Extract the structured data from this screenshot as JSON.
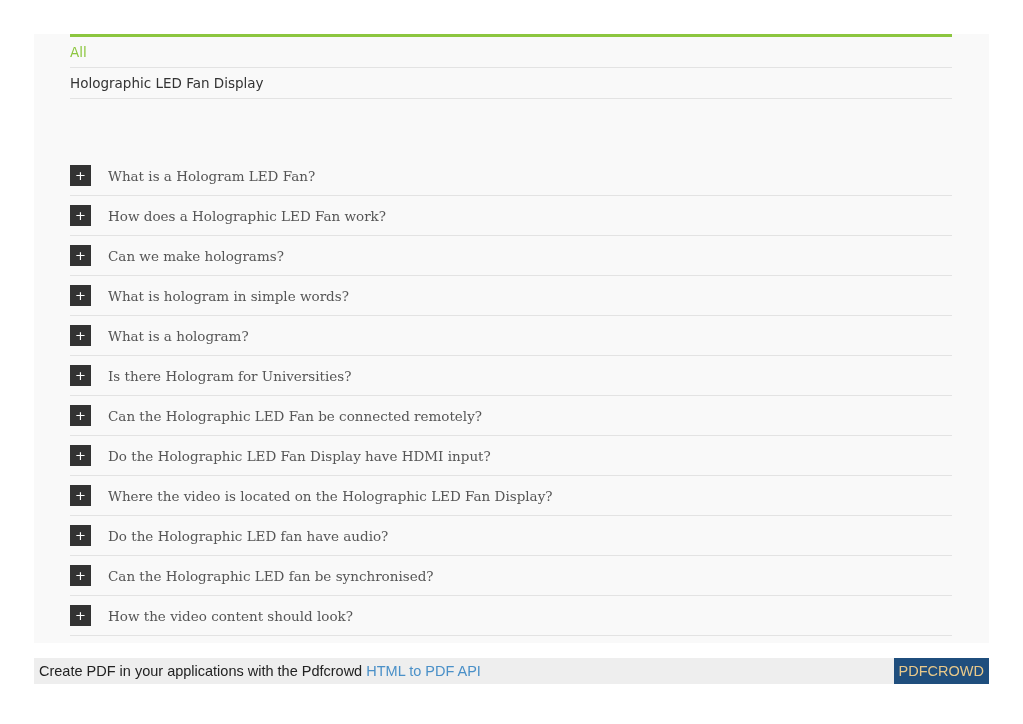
{
  "filters": [
    {
      "label": "All",
      "selected": true
    },
    {
      "label": "Holographic LED Fan Display",
      "selected": false
    }
  ],
  "faq": [
    {
      "toggle": "+",
      "question": "What is a Hologram LED Fan?",
      "expanded": false
    },
    {
      "toggle": "+",
      "question": "How does a Holographic LED Fan work?",
      "expanded": false
    },
    {
      "toggle": "+",
      "question": "Can we make holograms?",
      "expanded": false
    },
    {
      "toggle": "+",
      "question": "What is hologram in simple words?",
      "expanded": false
    },
    {
      "toggle": "+",
      "question": "What is a hologram?",
      "expanded": false
    },
    {
      "toggle": "+",
      "question": "Is there Hologram for Universities?",
      "expanded": false
    },
    {
      "toggle": "+",
      "question": "Can the Holographic LED Fan be connected remotely?",
      "expanded": false
    },
    {
      "toggle": "+",
      "question": "Do the Holographic LED Fan Display have HDMI input?",
      "expanded": false
    },
    {
      "toggle": "+",
      "question": "Where the video is located on the Holographic LED Fan Display?",
      "expanded": false
    },
    {
      "toggle": "+",
      "question": "Do the Holographic LED fan have audio?",
      "expanded": false
    },
    {
      "toggle": "+",
      "question": "Can the Holographic LED fan be synchronised?",
      "expanded": false
    },
    {
      "toggle": "+",
      "question": "How the video content should look?",
      "expanded": false
    }
  ],
  "footer": {
    "text": "Create PDF in your applications with the Pdfcrowd",
    "link": "HTML to PDF API",
    "badge": "PDFCROWD"
  }
}
